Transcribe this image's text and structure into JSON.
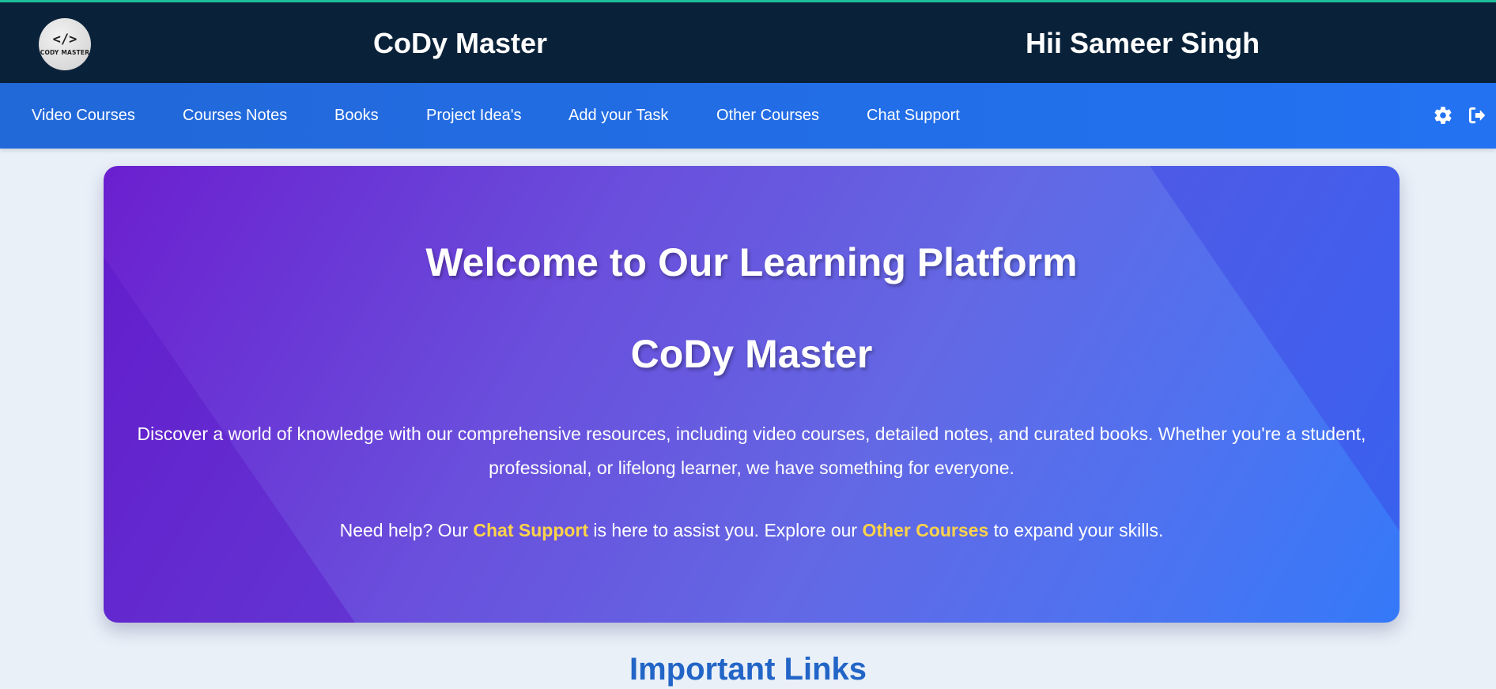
{
  "header": {
    "logo": {
      "glyph": "</>",
      "text": "CODY MASTER"
    },
    "brand_title": "CoDy Master",
    "greeting": "Hii Sameer Singh"
  },
  "nav": {
    "items": [
      {
        "label": "Video Courses"
      },
      {
        "label": "Courses Notes"
      },
      {
        "label": "Books"
      },
      {
        "label": "Project Idea's"
      },
      {
        "label": "Add your Task"
      },
      {
        "label": "Other Courses"
      },
      {
        "label": "Chat Support"
      }
    ],
    "icons": [
      "gear-icon",
      "logout-icon"
    ]
  },
  "hero": {
    "title": "Welcome to Our Learning Platform",
    "brand": "CoDy Master",
    "description": "Discover a world of knowledge with our comprehensive resources, including video courses, detailed notes, and curated books. Whether you're a student, professional, or lifelong learner, we have something for everyone.",
    "help_prefix": "Need help? Our ",
    "help_link_chat": "Chat Support",
    "help_middle": " is here to assist you. Explore our ",
    "help_link_courses": "Other Courses",
    "help_suffix": " to expand your skills."
  },
  "section": {
    "heading": "Important Links"
  },
  "colors": {
    "topbar": "#0a2239",
    "topbar_accent": "#1dbf9a",
    "navbar": "#2372f2",
    "highlight": "#fdd34a",
    "section_heading": "#2265c7",
    "page_bg": "#e9f0f8"
  }
}
